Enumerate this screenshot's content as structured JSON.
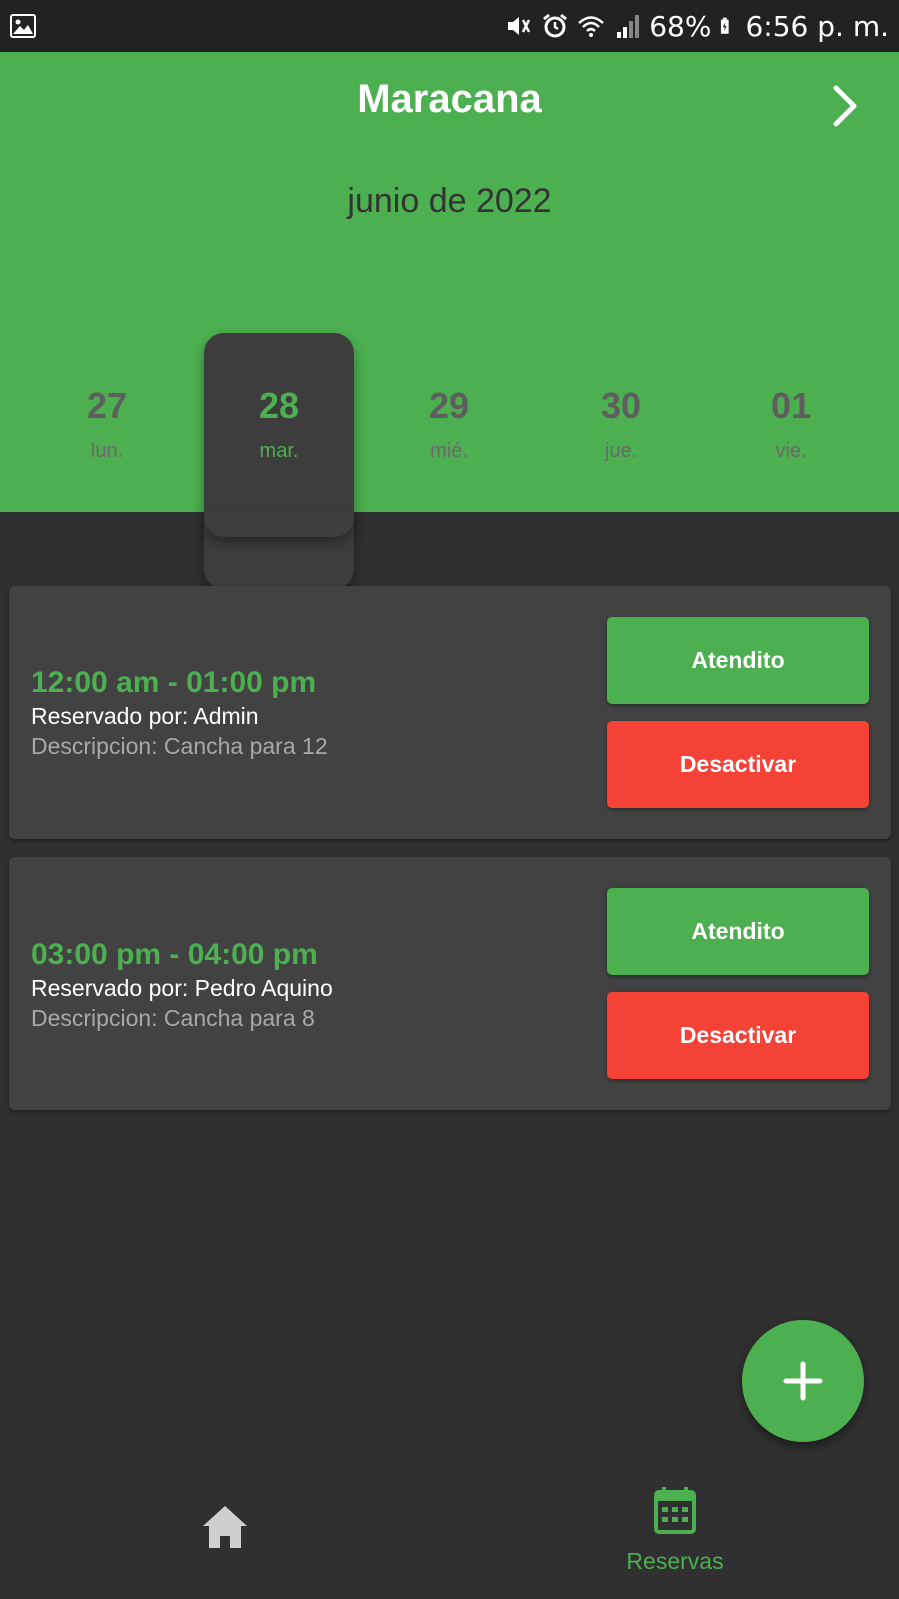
{
  "status_bar": {
    "battery": "68%",
    "time": "6:56 p. m."
  },
  "header": {
    "title": "Maracana",
    "month": "junio de 2022",
    "days": [
      {
        "num": "27",
        "name": "lun."
      },
      {
        "num": "28",
        "name": "mar."
      },
      {
        "num": "29",
        "name": "mié."
      },
      {
        "num": "30",
        "name": "jue."
      },
      {
        "num": "01",
        "name": "vie."
      }
    ],
    "selected_day": "28"
  },
  "reservations": [
    {
      "time": "12:00 am - 01:00 pm",
      "by": "Reservado por: Admin",
      "desc": "Descripcion: Cancha para 12",
      "attend_label": "Atendito",
      "deactivate_label": "Desactivar"
    },
    {
      "time": "03:00 pm - 04:00 pm",
      "by": "Reservado por: Pedro Aquino",
      "desc": "Descripcion: Cancha para 8",
      "attend_label": "Atendito",
      "deactivate_label": "Desactivar"
    }
  ],
  "bottom_nav": {
    "items": [
      {
        "icon": "home-icon",
        "label": ""
      },
      {
        "icon": "calendar-icon",
        "label": "Reservas"
      }
    ]
  },
  "colors": {
    "accent": "#4caf50",
    "danger": "#f44336",
    "background": "#303030",
    "card": "#424242"
  }
}
